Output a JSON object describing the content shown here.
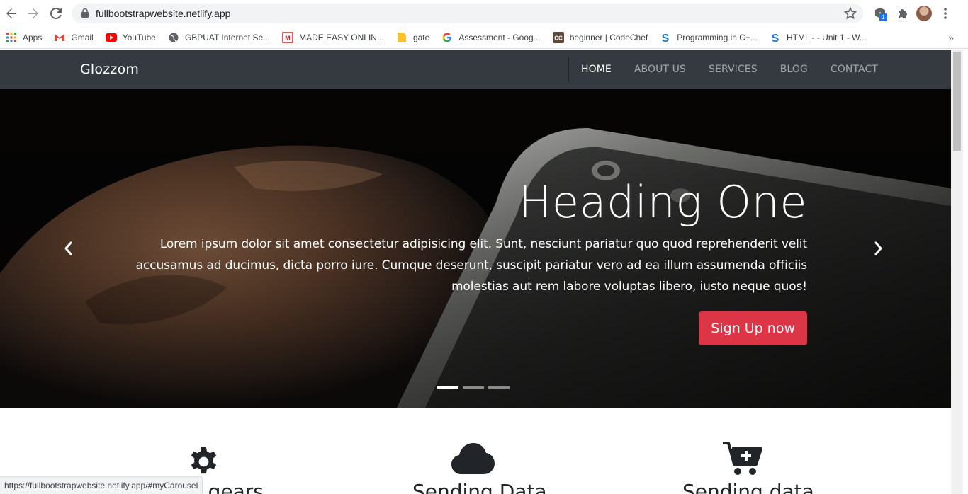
{
  "browser": {
    "url": "fullbootstrapwebsite.netlify.app",
    "extension_badge": "1",
    "bookmarks": [
      {
        "label": "Apps",
        "icon": "apps-grid-icon"
      },
      {
        "label": "Gmail",
        "icon": "gmail-icon"
      },
      {
        "label": "YouTube",
        "icon": "youtube-icon"
      },
      {
        "label": "GBPUAT Internet Se...",
        "icon": "globe-icon"
      },
      {
        "label": "MADE EASY ONLIN...",
        "icon": "madeeasy-icon"
      },
      {
        "label": "gate",
        "icon": "folder-icon"
      },
      {
        "label": "Assessment - Goog...",
        "icon": "google-icon"
      },
      {
        "label": "beginner | CodeChef",
        "icon": "codechef-icon"
      },
      {
        "label": "Programming in C+...",
        "icon": "s-icon"
      },
      {
        "label": "HTML - - Unit 1 - W...",
        "icon": "s-icon"
      }
    ],
    "more_bookmarks": "»",
    "status_url": "https://fullbootstrapwebsite.netlify.app/#myCarousel"
  },
  "navbar": {
    "brand": "Glozzom",
    "links": [
      "HOME",
      "ABOUT US",
      "SERVICES",
      "BLOG",
      "CONTACT"
    ],
    "active_index": 0
  },
  "carousel": {
    "heading": "Heading One",
    "text": "Lorem ipsum dolor sit amet consectetur adipisicing elit. Sunt, nesciunt pariatur quo quod reprehenderit velit accusamus ad ducimus, dicta porro iure. Cumque deserunt, suscipit pariatur vero ad ea illum assumenda officiis molestias aut rem labore voluptas libero, iusto neque quos!",
    "button": "Sign Up now",
    "slides": 3,
    "active_slide": 0
  },
  "features": [
    {
      "icon": "gear-icon",
      "title": "... gears"
    },
    {
      "icon": "cloud-icon",
      "title": "Sending Data"
    },
    {
      "icon": "cart-plus-icon",
      "title": "Sending data"
    }
  ],
  "colors": {
    "navbar_bg": "#343a40",
    "signup_button": "#dc3545",
    "icon_dark": "#212529"
  }
}
